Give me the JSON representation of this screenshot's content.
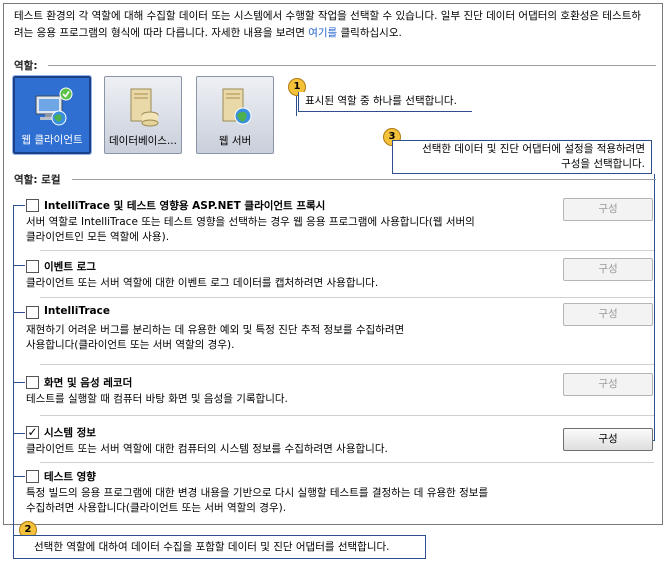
{
  "intro": {
    "text_before": "테스트 환경의 각 역할에 대해 수집할 데이터 또는 시스템에서 수행할 작업을 선택할 수 있습니다. 일부 진단 데이터 어댑터의 호환성은 테스트하려는 응용 프로그램의 형식에 따라 다릅니다. 자세한 내용을 보려면 ",
    "link": "여기를",
    "text_after": " 클릭하십시오."
  },
  "roles_label": "역할:",
  "roles": [
    {
      "label": "웹 클라이언트",
      "selected": true,
      "icon": "web-client-icon"
    },
    {
      "label": "데이터베이스...",
      "selected": false,
      "icon": "database-server-icon"
    },
    {
      "label": "웹 서버",
      "selected": false,
      "icon": "web-server-icon"
    }
  ],
  "role_section_label": "역할: 로컬",
  "callouts": [
    {
      "number": "1",
      "text": "표시된 역할 중 하나를 선택합니다."
    },
    {
      "number": "2",
      "text": "선택한 역할에 대하여 데이터 수집을 포함할 데이터 및 진단 어댑터를 선택합니다."
    },
    {
      "number": "3",
      "line1": "선택한 데이터 및 진단 어댑터에 설정을 적용하려면",
      "line2": "구성을 선택합니다."
    }
  ],
  "configure_label": "구성",
  "adapters": [
    {
      "title": "IntelliTrace 및 테스트 영향용 ASP.NET 클라이언트 프록시",
      "checked": false,
      "line1": "서버 역할로 IntelliTrace 또는 테스트 영향을 선택하는 경우 웹 응용 프로그램에 사용합니다(웹 서버의",
      "line2": "클라이언트인 모든 역할에 사용)."
    },
    {
      "title": "이벤트 로그",
      "checked": false,
      "line1": "클라이언트 또는 서버 역할에 대한 이벤트 로그 데이터를 캡처하려면 사용합니다.",
      "line2": ""
    },
    {
      "title": "IntelliTrace",
      "checked": false,
      "line1": "재현하기 어려운 버그를 분리하는 데 유용한 예외 및 특정 진단 추적 정보를 수집하려면",
      "line2": "사용합니다(클라이언트 또는 서버 역할의 경우)."
    },
    {
      "title": "화면 및 음성 레코더",
      "checked": false,
      "line1": "테스트를 실행할 때 컴퓨터 바탕 화면 및 음성을 기록합니다.",
      "line2": ""
    },
    {
      "title": "시스템 정보",
      "checked": true,
      "line1": "클라이언트 또는 서버 역할에 대한 컴퓨터의 시스템 정보를 수집하려면 사용합니다.",
      "line2": ""
    },
    {
      "title": "테스트 영향",
      "checked": false,
      "line1": "특정 빌드의 응용 프로그램에 대한 변경 내용을 기반으로 다시 실행할 테스트를 결정하는 데 유용한 정보를",
      "line2": "수집하려면 사용합니다(클라이언트 또는 서버 역할의 경우)."
    }
  ],
  "colors": {
    "selected_role": "#2f6fd1",
    "callout_border": "#2d4f8c",
    "badge": "#f3c23a",
    "link": "#1f5fd0"
  }
}
